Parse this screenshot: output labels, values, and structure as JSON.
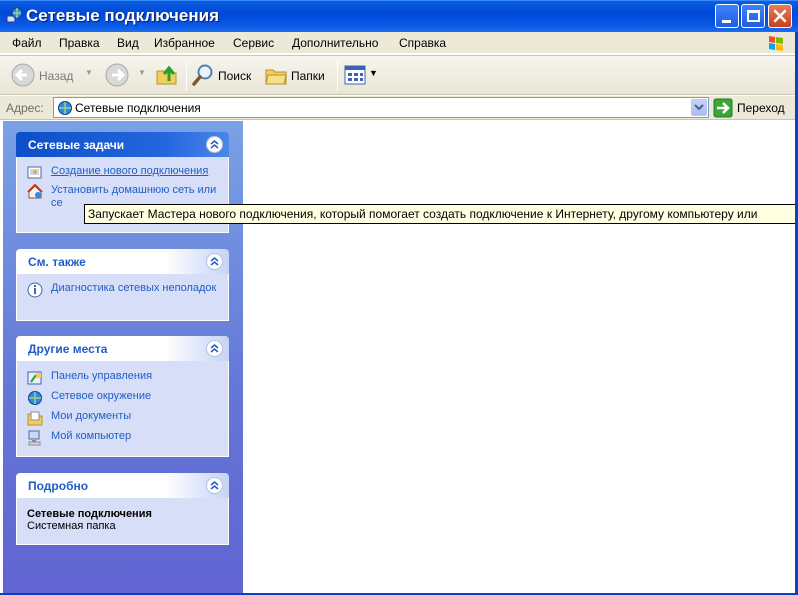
{
  "window": {
    "title": "Сетевые подключения"
  },
  "menu": [
    "Файл",
    "Правка",
    "Вид",
    "Избранное",
    "Сервис",
    "Дополнительно",
    "Справка"
  ],
  "toolbar": {
    "back": "Назад",
    "search": "Поиск",
    "folders": "Папки"
  },
  "address": {
    "label": "Адрес:",
    "value": "Сетевые подключения",
    "go": "Переход"
  },
  "panels": {
    "network_tasks": {
      "title": "Сетевые задачи",
      "items": [
        {
          "label": "Создание нового подключения",
          "icon": "new-connection-icon"
        },
        {
          "label": "Установить домашнюю сеть или се",
          "icon": "home-network-icon"
        }
      ]
    },
    "see_also": {
      "title": "См. также",
      "items": [
        {
          "label": "Диагностика сетевых неполадок",
          "icon": "info-icon"
        }
      ]
    },
    "other_places": {
      "title": "Другие места",
      "items": [
        {
          "label": "Панель управления",
          "icon": "control-panel-icon"
        },
        {
          "label": "Сетевое окружение",
          "icon": "network-places-icon"
        },
        {
          "label": "Мои документы",
          "icon": "my-documents-icon"
        },
        {
          "label": "Мой компьютер",
          "icon": "my-computer-icon"
        }
      ]
    },
    "details": {
      "title": "Подробно",
      "name": "Сетевые подключения",
      "type": "Системная папка"
    }
  },
  "tooltip": "Запускает Мастера нового подключения, который помогает создать подключение к Интернету, другому компьютеру или"
}
